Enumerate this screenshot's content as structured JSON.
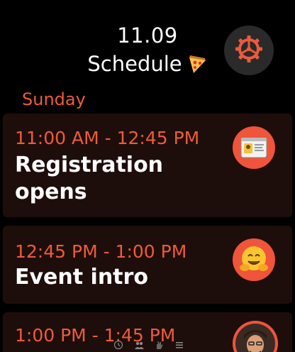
{
  "header": {
    "time": "11.09",
    "title": "Schedule"
  },
  "section": {
    "label": "Sunday"
  },
  "events": [
    {
      "time_range": "11:00 AM - 12:45 PM",
      "title": "Registration opens",
      "icon": "id-badge-icon"
    },
    {
      "time_range": "12:45 PM - 1:00 PM",
      "title": "Event intro",
      "icon": "hugging-face-emoji-icon"
    },
    {
      "time_range": "1:00 PM - 1:45 PM",
      "title": "",
      "icon": "speaker-avatar"
    }
  ],
  "colors": {
    "accent": "#ee5a3c",
    "card_bg": "#1e0e0b",
    "background": "#000000",
    "icon_circle": "#f0543a"
  },
  "bottom_bar": [
    "clock-icon",
    "people-icon",
    "hand-icon",
    "list-icon"
  ]
}
